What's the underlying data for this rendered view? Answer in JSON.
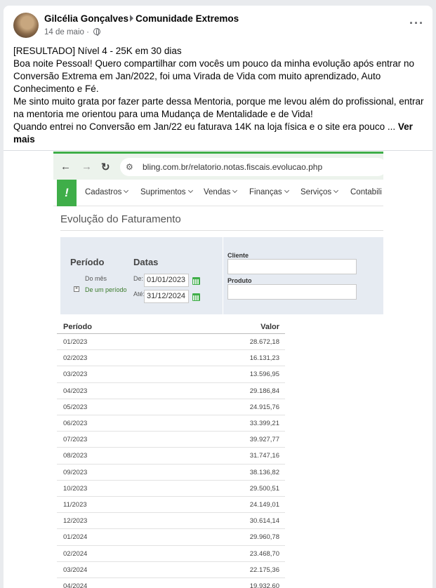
{
  "post": {
    "author": "Gilcélia Gonçalves",
    "group": "Comunidade Extremos",
    "date": "14 de maio",
    "more_label": "···",
    "lines": [
      "[RESULTADO] Nível 4 - 25K em 30 dias",
      "Boa noite Pessoal! Quero compartilhar com vocês um pouco da minha evolução após entrar no Conversão Extrema em Jan/2022, foi uma Virada de Vida com muito aprendizado, Auto Conhecimento e Fé.",
      "Me sinto muito grata por fazer parte dessa Mentoria, porque me levou além do profissional, entrar na mentoria me orientou para uma Mudança de Mentalidade e de Vida!",
      "Quando entrei no Conversão em Jan/22 eu faturava 14K na loja física e o site era pouco ..."
    ],
    "see_more": "Ver mais"
  },
  "screenshot": {
    "url": "bling.com.br/relatorio.notas.fiscais.evolucao.php",
    "logo": "!",
    "menu": [
      "Cadastros",
      "Suprimentos",
      "Vendas",
      "Finanças",
      "Serviços",
      "Contabili"
    ],
    "page_title": "Evolução do Faturamento",
    "filters": {
      "periodo_label": "Período",
      "datas_label": "Datas",
      "do_mes": "Do mês",
      "de_um_periodo": "De um período",
      "de_label": "De:",
      "ate_label": "Até:",
      "de_value": "01/01/2023",
      "ate_value": "31/12/2024",
      "cliente_label": "Cliente",
      "produto_label": "Produto"
    },
    "table": {
      "headers": [
        "Período",
        "Valor"
      ],
      "rows": [
        {
          "periodo": "01/2023",
          "valor": "28.672,18"
        },
        {
          "periodo": "02/2023",
          "valor": "16.131,23"
        },
        {
          "periodo": "03/2023",
          "valor": "13.596,95"
        },
        {
          "periodo": "04/2023",
          "valor": "29.186,84"
        },
        {
          "periodo": "05/2023",
          "valor": "24.915,76"
        },
        {
          "periodo": "06/2023",
          "valor": "33.399,21"
        },
        {
          "periodo": "07/2023",
          "valor": "39.927,77"
        },
        {
          "periodo": "08/2023",
          "valor": "31.747,16"
        },
        {
          "periodo": "09/2023",
          "valor": "38.136,82"
        },
        {
          "periodo": "10/2023",
          "valor": "29.500,51"
        },
        {
          "periodo": "11/2023",
          "valor": "24.149,01"
        },
        {
          "periodo": "12/2023",
          "valor": "30.614,14"
        },
        {
          "periodo": "01/2024",
          "valor": "29.960,78"
        },
        {
          "periodo": "02/2024",
          "valor": "23.468,70"
        },
        {
          "periodo": "03/2024",
          "valor": "22.175,36"
        },
        {
          "periodo": "04/2024",
          "valor": "19.932,60"
        }
      ]
    }
  },
  "colors": {
    "brand_green": "#3fae49",
    "filter_bg": "#e6ebf2",
    "muted_text": "#65676b"
  },
  "icons": {
    "back": "back-arrow-icon",
    "forward": "forward-arrow-icon",
    "reload": "reload-icon",
    "site_info": "tune-icon",
    "calendar": "calendar-icon",
    "globe": "globe-icon"
  }
}
